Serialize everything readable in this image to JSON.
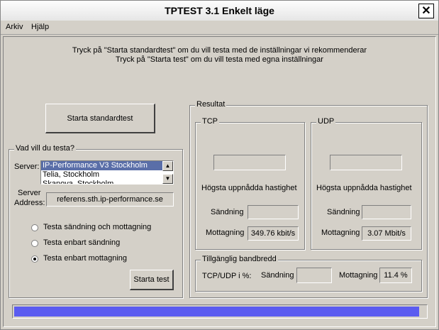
{
  "window": {
    "title": "TPTEST 3.1 Enkelt läge",
    "close_glyph": "✕"
  },
  "menu": {
    "items": [
      "Arkiv",
      "Hjälp"
    ]
  },
  "intro": {
    "line1": "Tryck på \"Starta standardtest\" om du vill testa med de inställningar vi rekommenderar",
    "line2": "Tryck på \"Starta test\" om du vill testa med egna inställningar"
  },
  "standard_button": "Starta standardtest",
  "test_group": {
    "title": "Vad vill du testa?",
    "server_label": "Server:",
    "servers": [
      "IP-Performance V3 Stockholm",
      "Telia, Stockholm",
      "Skanova, Stockholm"
    ],
    "selected_index": 0,
    "address_label_1": "Server",
    "address_label_2": "Address:",
    "address_value": "referens.sth.ip-performance.se",
    "options": [
      {
        "label": "Testa sändning och mottagning",
        "checked": false
      },
      {
        "label": "Testa enbart sändning",
        "checked": false
      },
      {
        "label": "Testa enbart mottagning",
        "checked": true
      }
    ],
    "start_button": "Starta test"
  },
  "result": {
    "title": "Resultat",
    "tcp": {
      "title": "TCP",
      "top_value": "",
      "highest_label": "Högsta uppnådda hastighet",
      "send_label": "Sändning",
      "send_value": "",
      "recv_label": "Mottagning",
      "recv_value": "349.76 kbit/s"
    },
    "udp": {
      "title": "UDP",
      "top_value": "",
      "highest_label": "Högsta uppnådda hastighet",
      "send_label": "Sändning",
      "send_value": "",
      "recv_label": "Mottagning",
      "recv_value": "3.07 Mbit/s"
    },
    "bandwidth": {
      "title": "Tillgänglig bandbredd",
      "label": "TCP/UDP i %:",
      "send_label": "Sändning",
      "send_value": "",
      "recv_label": "Mottagning",
      "recv_value": "11.4 %"
    }
  },
  "progress": {
    "value": 0.985,
    "color": "#5b5cf0"
  }
}
